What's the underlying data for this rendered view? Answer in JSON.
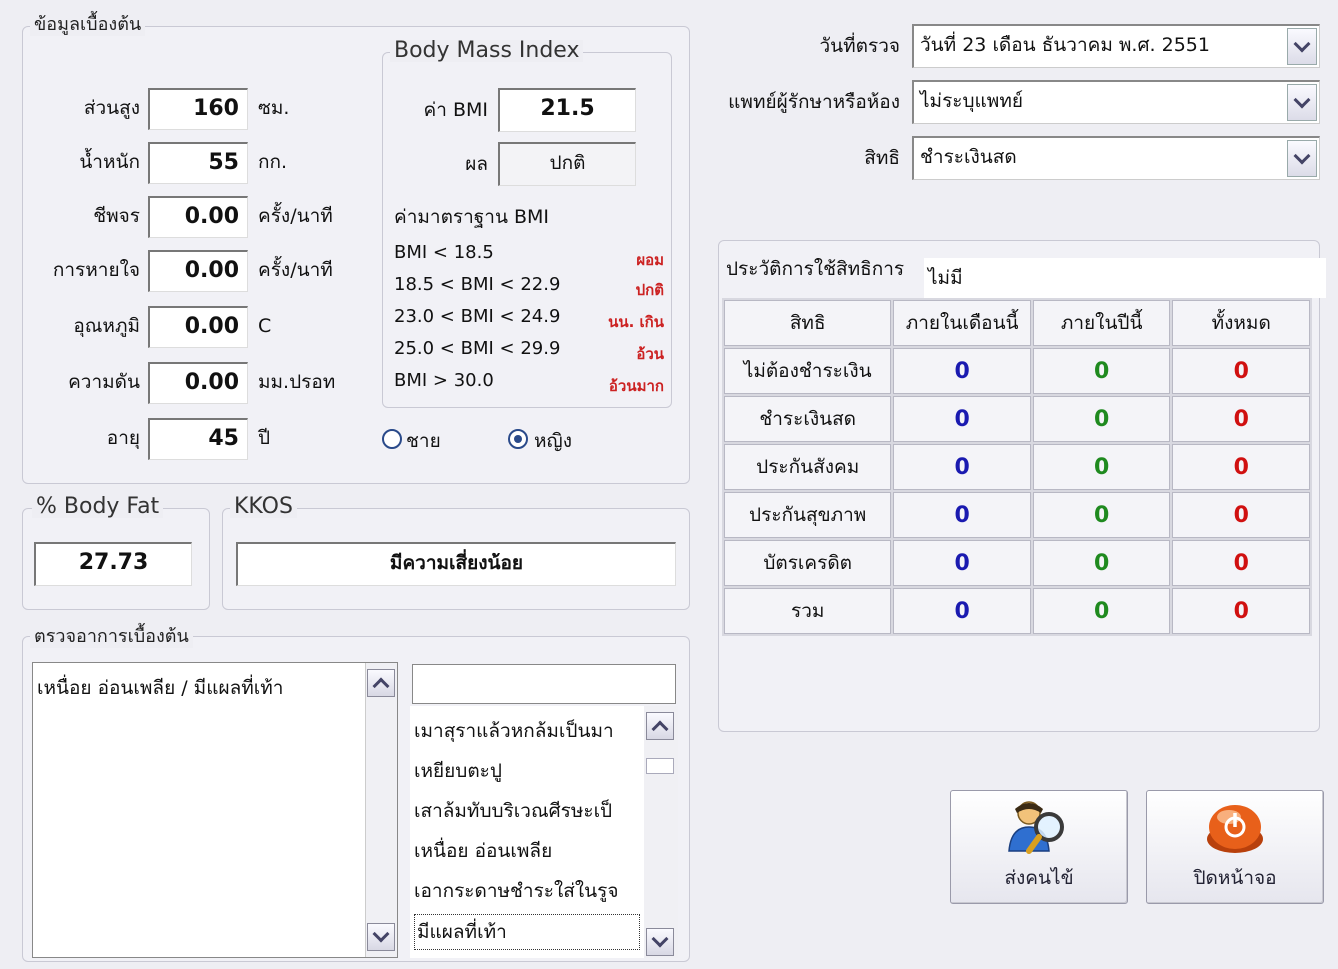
{
  "basic_info": {
    "legend": "ข้อมูลเบื้องต้น",
    "height": {
      "label": "ส่วนสูง",
      "value": "160",
      "unit": "ซม."
    },
    "weight": {
      "label": "น้ำหนัก",
      "value": "55",
      "unit": "กก."
    },
    "pulse": {
      "label": "ชีพจร",
      "value": "0.00",
      "unit": "ครั้ง/นาที"
    },
    "respiration": {
      "label": "การหายใจ",
      "value": "0.00",
      "unit": "ครั้ง/นาที"
    },
    "temperature": {
      "label": "อุณหภูมิ",
      "value": "0.00",
      "unit": "C"
    },
    "pressure": {
      "label": "ความดัน",
      "value": "0.00",
      "unit": "มม.ปรอท"
    },
    "age": {
      "label": "อายุ",
      "value": "45",
      "unit": "ปี"
    },
    "sex_male": "ชาย",
    "sex_female": "หญิง",
    "sex_selected": "female"
  },
  "bmi": {
    "legend": "Body Mass Index",
    "value_label": "ค่า BMI",
    "value": "21.5",
    "result_label": "ผล",
    "result": "ปกติ",
    "standard_title": "ค่ามาตราฐาน BMI",
    "standards": [
      {
        "range": "BMI < 18.5",
        "tag": "ผอม"
      },
      {
        "range": "18.5 < BMI < 22.9",
        "tag": "ปกติ"
      },
      {
        "range": "23.0 < BMI < 24.9",
        "tag": "นน. เกิน"
      },
      {
        "range": "25.0 < BMI < 29.9",
        "tag": "อ้วน"
      },
      {
        "range": "BMI > 30.0",
        "tag": "อ้วนมาก"
      }
    ]
  },
  "body_fat": {
    "legend": "% Body Fat",
    "value": "27.73"
  },
  "kkos": {
    "legend": "KKOS",
    "value": "มีความเสี่ยงน้อย"
  },
  "symptoms": {
    "legend": "ตรวจอาการเบื้องต้น",
    "text": "เหนื่อย อ่อนเพลีย / มีแผลที่เท้า",
    "search_value": "",
    "options": [
      "เมาสุราแล้วหกล้มเป็นมา",
      "เหยียบตะปู",
      "เสาล้มทับบริเวณศีรษะเป็",
      "เหนื่อย อ่อนเพลีย",
      "เอากระดาษชำระใส่ในรูจ",
      "มีแผลที่เท้า"
    ]
  },
  "exam_date": {
    "label": "วันที่ตรวจ",
    "value": "วันที่ 23 เดือน  ธันวาคม   พ.ศ.  2551"
  },
  "doctor": {
    "label": "แพทย์ผู้รักษาหรือห้อง",
    "value": "ไม่ระบุแพทย์"
  },
  "rights": {
    "label": "สิทธิ",
    "value": "ชำระเงินสด"
  },
  "history": {
    "legend": "ประวัติการใช้สิทธิการ",
    "extra": "ไม่มี",
    "columns": [
      "สิทธิ",
      "ภายในเดือนนี้",
      "ภายในปีนี้",
      "ทั้งหมด"
    ],
    "rows": [
      {
        "name": "ไม่ต้องชำระเงิน",
        "month": "0",
        "year": "0",
        "total": "0"
      },
      {
        "name": "ชำระเงินสด",
        "month": "0",
        "year": "0",
        "total": "0"
      },
      {
        "name": "ประกันสังคม",
        "month": "0",
        "year": "0",
        "total": "0"
      },
      {
        "name": "ประกันสุขภาพ",
        "month": "0",
        "year": "0",
        "total": "0"
      },
      {
        "name": "บัตรเครดิต",
        "month": "0",
        "year": "0",
        "total": "0"
      },
      {
        "name": "รวม",
        "month": "0",
        "year": "0",
        "total": "0"
      }
    ]
  },
  "buttons": {
    "send": "ส่งคนไข้",
    "close": "ปิดหน้าจอ"
  },
  "icons": {
    "send": "doctor-search-icon",
    "close": "power-icon"
  },
  "colors": {
    "accent_red": "#d01010",
    "blue": "#1a1ab0",
    "green": "#1f8a1f"
  }
}
